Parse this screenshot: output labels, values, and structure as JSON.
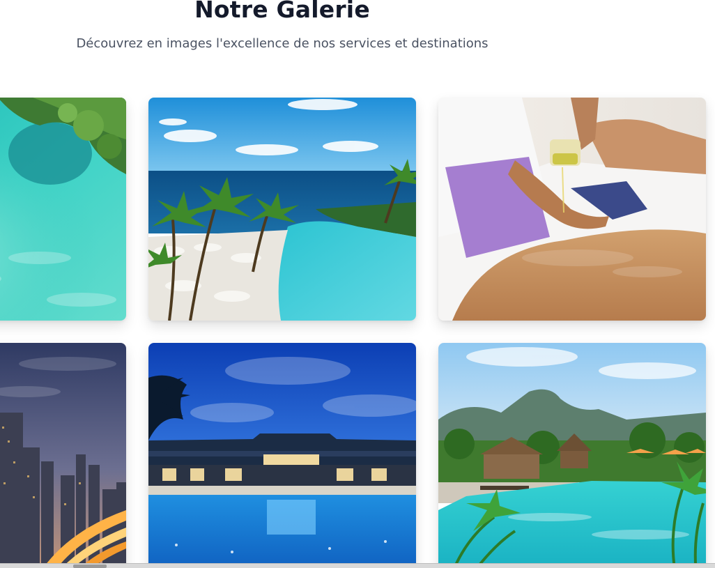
{
  "gallery": {
    "title": "Notre Galerie",
    "subtitle": "Découvrez en images l'excellence de nos services et destinations",
    "images": [
      {
        "subject": "aerial turquoise lagoon with islet"
      },
      {
        "subject": "clifftop infinity pool with palm trees and ocean"
      },
      {
        "subject": "spa massage with oil being poured"
      },
      {
        "subject": "city skyline at dusk with light trails"
      },
      {
        "subject": "modern resort pool at twilight"
      },
      {
        "subject": "tropical thatched villas with pool and mountains"
      }
    ]
  },
  "colors": {
    "title": "#141a2b",
    "subtitle": "#4a5262"
  }
}
